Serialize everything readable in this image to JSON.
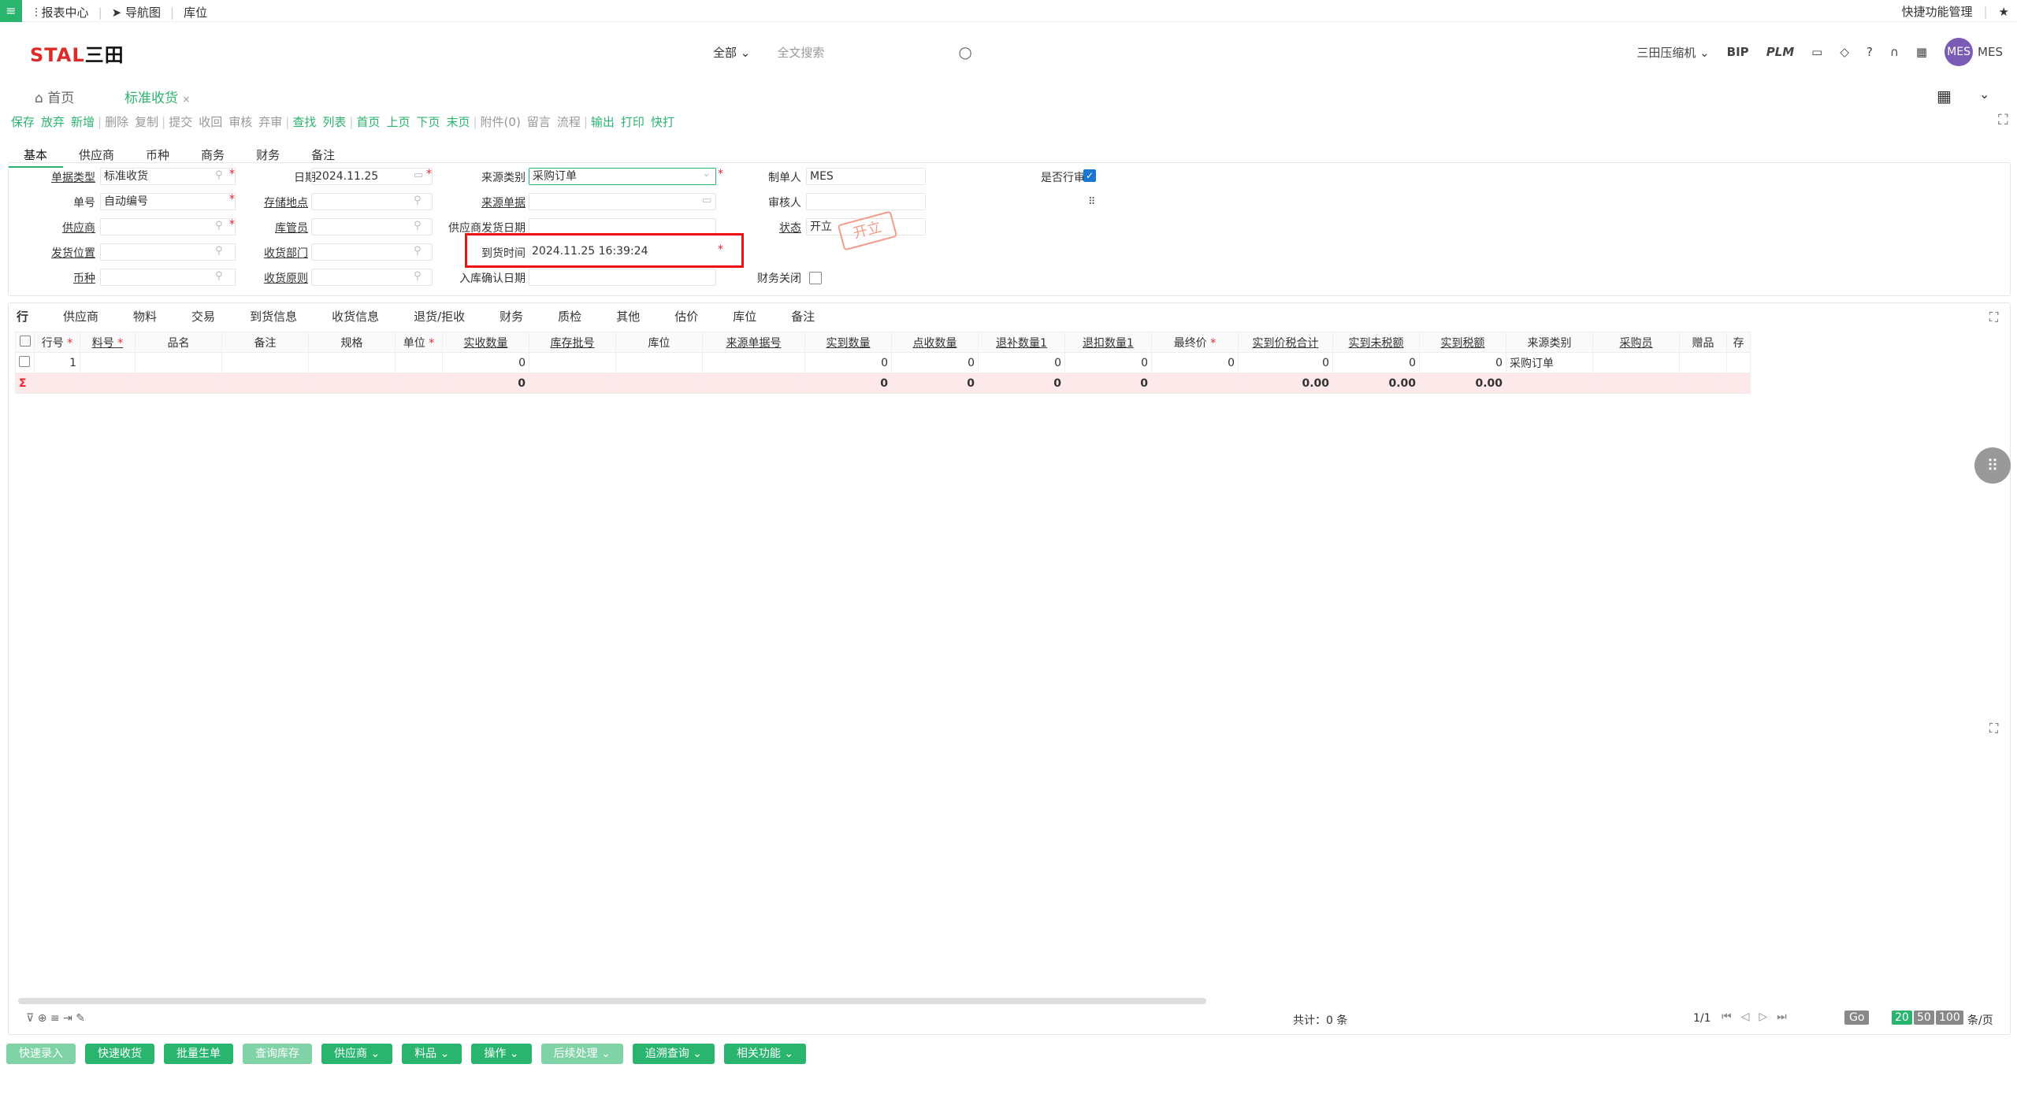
{
  "topnav": {
    "reports": "报表中心",
    "navmap": "导航图",
    "location": "库位",
    "quick": "快捷功能管理"
  },
  "header": {
    "logo_a": "STAL",
    "logo_b": "三田",
    "scope": "全部",
    "search_placeholder": "全文搜索",
    "company": "三田压缩机",
    "bip": "BIP",
    "plm": "PLM",
    "avatar": "MES",
    "user": "MES"
  },
  "tabs": {
    "home": "首页",
    "current": "标准收货"
  },
  "toolbar": [
    {
      "label": "保存",
      "enabled": true
    },
    {
      "label": "放弃",
      "enabled": true
    },
    {
      "label": "新增",
      "enabled": true
    },
    {
      "label": "删除",
      "enabled": false
    },
    {
      "label": "复制",
      "enabled": false
    },
    {
      "label": "提交",
      "enabled": false
    },
    {
      "label": "收回",
      "enabled": false
    },
    {
      "label": "审核",
      "enabled": false
    },
    {
      "label": "弃审",
      "enabled": false
    },
    {
      "label": "查找",
      "enabled": true
    },
    {
      "label": "列表",
      "enabled": true
    },
    {
      "label": "首页",
      "enabled": true
    },
    {
      "label": "上页",
      "enabled": true
    },
    {
      "label": "下页",
      "enabled": true
    },
    {
      "label": "末页",
      "enabled": true
    },
    {
      "label": "附件(0)",
      "enabled": false
    },
    {
      "label": "留言",
      "enabled": false
    },
    {
      "label": "流程",
      "enabled": false
    },
    {
      "label": "输出",
      "enabled": true
    },
    {
      "label": "打印",
      "enabled": true
    },
    {
      "label": "快打",
      "enabled": true
    }
  ],
  "subtabs": [
    "基本",
    "供应商",
    "币种",
    "商务",
    "财务",
    "备注"
  ],
  "form": {
    "doc_type_label": "单据类型",
    "doc_type": "标准收货",
    "date_label": "日期",
    "date": "2024.11.25",
    "source_type_label": "来源类别",
    "source_type": "采购订单",
    "creator_label": "制单人",
    "creator": "MES",
    "audit_label": "是否行审",
    "doc_no_label": "单号",
    "doc_no": "自动编号",
    "storage_label": "存储地点",
    "source_doc_label": "来源单据",
    "auditor_label": "审核人",
    "supplier_label": "供应商",
    "keeper_label": "库管员",
    "supplier_ship_label": "供应商发货日期",
    "status_label": "状态",
    "status": "开立",
    "stamp": "开立",
    "ship_loc_label": "发货位置",
    "recv_dept_label": "收货部门",
    "arrival_label": "到货时间",
    "arrival": "2024.11.25 16:39:24",
    "currency_label": "币种",
    "recv_rule_label": "收货原则",
    "instock_label": "入库确认日期",
    "fin_close_label": "财务关闭"
  },
  "grid": {
    "tabs": [
      "行",
      "供应商",
      "物料",
      "交易",
      "到货信息",
      "收货信息",
      "退货/拒收",
      "财务",
      "质检",
      "其他",
      "估价",
      "库位",
      "备注"
    ],
    "headers": [
      "行号",
      "料号",
      "品名",
      "备注",
      "规格",
      "单位",
      "实收数量",
      "库存批号",
      "库位",
      "来源单据号",
      "实到数量",
      "点收数量",
      "退补数量1",
      "退扣数量1",
      "最终价",
      "实到价税合计",
      "实到未税额",
      "实到税额",
      "来源类别",
      "采购员",
      "赠品",
      "存"
    ],
    "row": [
      "1",
      "",
      "",
      "",
      "",
      "",
      "0",
      "",
      "",
      "",
      "0",
      "0",
      "0",
      "0",
      "0",
      "0",
      "0",
      "0",
      "采购订单",
      "",
      "",
      ""
    ],
    "sum": [
      "",
      "",
      "",
      "",
      "",
      "",
      "0",
      "",
      "",
      "",
      "0",
      "0",
      "0",
      "0",
      "",
      "0.00",
      "0.00",
      "0.00",
      "",
      "",
      "",
      ""
    ],
    "total": "共计：0 条",
    "pager": "1/1",
    "go": "Go",
    "sizes": [
      "20",
      "50",
      "100"
    ],
    "per": "条/页"
  },
  "bottom_buttons": [
    {
      "label": "快速录入",
      "light": true
    },
    {
      "label": "快速收货",
      "light": false
    },
    {
      "label": "批量生单",
      "light": false
    },
    {
      "label": "查询库存",
      "light": true
    },
    {
      "label": "供应商 ⌄",
      "light": false
    },
    {
      "label": "料品 ⌄",
      "light": false
    },
    {
      "label": "操作 ⌄",
      "light": false
    },
    {
      "label": "后续处理 ⌄",
      "light": true
    },
    {
      "label": "追溯查询 ⌄",
      "light": false
    },
    {
      "label": "相关功能 ⌄",
      "light": false
    }
  ]
}
